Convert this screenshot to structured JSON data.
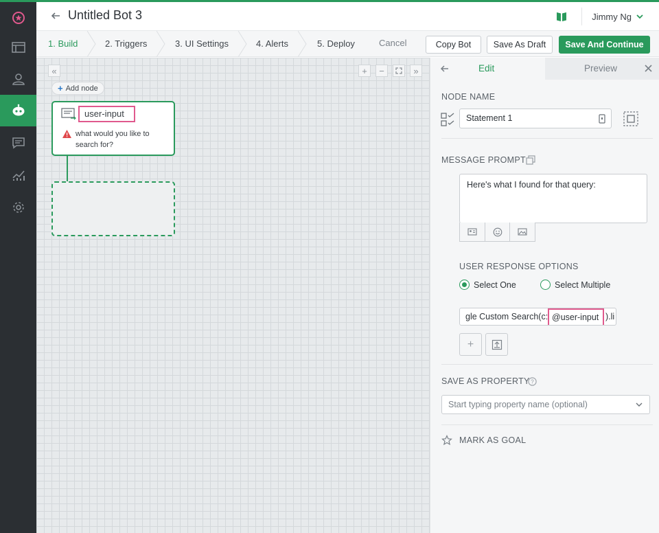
{
  "header": {
    "title": "Untitled Bot 3",
    "user": "Jimmy Ng"
  },
  "steps": [
    "1. Build",
    "2. Triggers",
    "3. UI Settings",
    "4. Alerts",
    "5. Deploy"
  ],
  "actions": {
    "cancel": "Cancel",
    "copy": "Copy Bot",
    "draft": "Save As Draft",
    "save": "Save And Continue"
  },
  "canvas": {
    "add_node": "Add node",
    "node": {
      "name": "user-input",
      "text": "what would you like to search for?"
    }
  },
  "panel": {
    "tab_edit": "Edit",
    "tab_preview": "Preview",
    "node_name_title": "NODE NAME",
    "node_name_value": "Statement 1",
    "message_prompt_title": "MESSAGE PROMPT",
    "message_prompt_value": "Here's what I found for that query:",
    "user_response_title": "USER RESPONSE OPTIONS",
    "radio_one": "Select One",
    "radio_multi": "Select Multiple",
    "response_prefix": "gle Custom Search(c:",
    "response_highlight": "@user-input",
    "response_suffix": ").li",
    "save_property_title": "SAVE AS PROPERTY",
    "save_property_placeholder": "Start typing property name (optional)",
    "goal": "MARK AS GOAL"
  },
  "colors": {
    "accent": "#2a9a5c",
    "highlight": "#e0598d",
    "sidebar": "#2b2f33"
  }
}
